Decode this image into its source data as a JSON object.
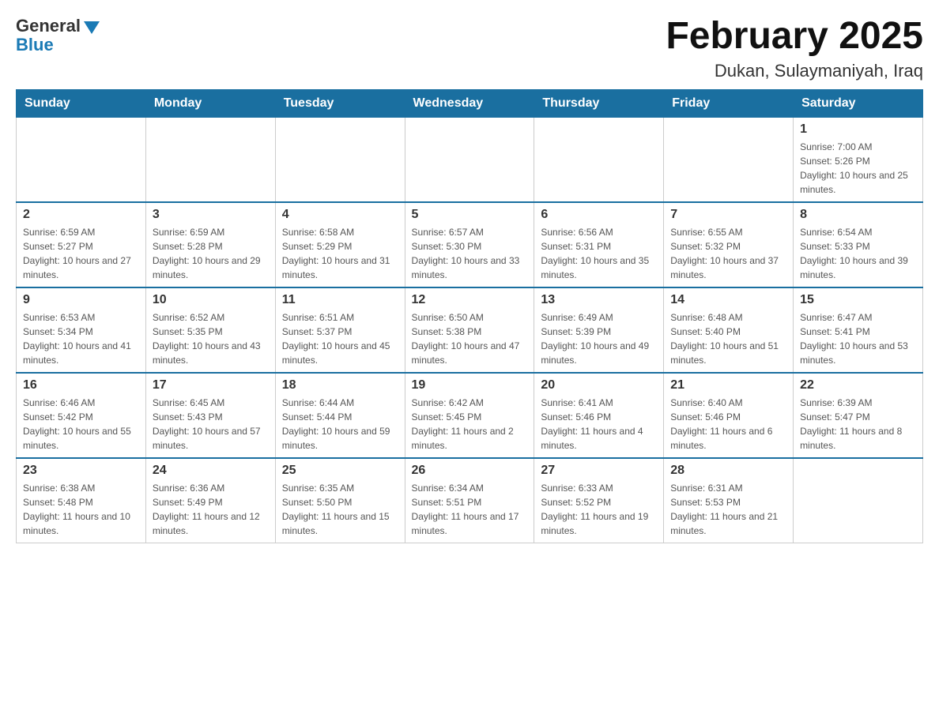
{
  "header": {
    "logo_general": "General",
    "logo_blue": "Blue",
    "title": "February 2025",
    "subtitle": "Dukan, Sulaymaniyah, Iraq"
  },
  "days_of_week": [
    "Sunday",
    "Monday",
    "Tuesday",
    "Wednesday",
    "Thursday",
    "Friday",
    "Saturday"
  ],
  "weeks": [
    [
      {
        "day": "",
        "sunrise": "",
        "sunset": "",
        "daylight": ""
      },
      {
        "day": "",
        "sunrise": "",
        "sunset": "",
        "daylight": ""
      },
      {
        "day": "",
        "sunrise": "",
        "sunset": "",
        "daylight": ""
      },
      {
        "day": "",
        "sunrise": "",
        "sunset": "",
        "daylight": ""
      },
      {
        "day": "",
        "sunrise": "",
        "sunset": "",
        "daylight": ""
      },
      {
        "day": "",
        "sunrise": "",
        "sunset": "",
        "daylight": ""
      },
      {
        "day": "1",
        "sunrise": "Sunrise: 7:00 AM",
        "sunset": "Sunset: 5:26 PM",
        "daylight": "Daylight: 10 hours and 25 minutes."
      }
    ],
    [
      {
        "day": "2",
        "sunrise": "Sunrise: 6:59 AM",
        "sunset": "Sunset: 5:27 PM",
        "daylight": "Daylight: 10 hours and 27 minutes."
      },
      {
        "day": "3",
        "sunrise": "Sunrise: 6:59 AM",
        "sunset": "Sunset: 5:28 PM",
        "daylight": "Daylight: 10 hours and 29 minutes."
      },
      {
        "day": "4",
        "sunrise": "Sunrise: 6:58 AM",
        "sunset": "Sunset: 5:29 PM",
        "daylight": "Daylight: 10 hours and 31 minutes."
      },
      {
        "day": "5",
        "sunrise": "Sunrise: 6:57 AM",
        "sunset": "Sunset: 5:30 PM",
        "daylight": "Daylight: 10 hours and 33 minutes."
      },
      {
        "day": "6",
        "sunrise": "Sunrise: 6:56 AM",
        "sunset": "Sunset: 5:31 PM",
        "daylight": "Daylight: 10 hours and 35 minutes."
      },
      {
        "day": "7",
        "sunrise": "Sunrise: 6:55 AM",
        "sunset": "Sunset: 5:32 PM",
        "daylight": "Daylight: 10 hours and 37 minutes."
      },
      {
        "day": "8",
        "sunrise": "Sunrise: 6:54 AM",
        "sunset": "Sunset: 5:33 PM",
        "daylight": "Daylight: 10 hours and 39 minutes."
      }
    ],
    [
      {
        "day": "9",
        "sunrise": "Sunrise: 6:53 AM",
        "sunset": "Sunset: 5:34 PM",
        "daylight": "Daylight: 10 hours and 41 minutes."
      },
      {
        "day": "10",
        "sunrise": "Sunrise: 6:52 AM",
        "sunset": "Sunset: 5:35 PM",
        "daylight": "Daylight: 10 hours and 43 minutes."
      },
      {
        "day": "11",
        "sunrise": "Sunrise: 6:51 AM",
        "sunset": "Sunset: 5:37 PM",
        "daylight": "Daylight: 10 hours and 45 minutes."
      },
      {
        "day": "12",
        "sunrise": "Sunrise: 6:50 AM",
        "sunset": "Sunset: 5:38 PM",
        "daylight": "Daylight: 10 hours and 47 minutes."
      },
      {
        "day": "13",
        "sunrise": "Sunrise: 6:49 AM",
        "sunset": "Sunset: 5:39 PM",
        "daylight": "Daylight: 10 hours and 49 minutes."
      },
      {
        "day": "14",
        "sunrise": "Sunrise: 6:48 AM",
        "sunset": "Sunset: 5:40 PM",
        "daylight": "Daylight: 10 hours and 51 minutes."
      },
      {
        "day": "15",
        "sunrise": "Sunrise: 6:47 AM",
        "sunset": "Sunset: 5:41 PM",
        "daylight": "Daylight: 10 hours and 53 minutes."
      }
    ],
    [
      {
        "day": "16",
        "sunrise": "Sunrise: 6:46 AM",
        "sunset": "Sunset: 5:42 PM",
        "daylight": "Daylight: 10 hours and 55 minutes."
      },
      {
        "day": "17",
        "sunrise": "Sunrise: 6:45 AM",
        "sunset": "Sunset: 5:43 PM",
        "daylight": "Daylight: 10 hours and 57 minutes."
      },
      {
        "day": "18",
        "sunrise": "Sunrise: 6:44 AM",
        "sunset": "Sunset: 5:44 PM",
        "daylight": "Daylight: 10 hours and 59 minutes."
      },
      {
        "day": "19",
        "sunrise": "Sunrise: 6:42 AM",
        "sunset": "Sunset: 5:45 PM",
        "daylight": "Daylight: 11 hours and 2 minutes."
      },
      {
        "day": "20",
        "sunrise": "Sunrise: 6:41 AM",
        "sunset": "Sunset: 5:46 PM",
        "daylight": "Daylight: 11 hours and 4 minutes."
      },
      {
        "day": "21",
        "sunrise": "Sunrise: 6:40 AM",
        "sunset": "Sunset: 5:46 PM",
        "daylight": "Daylight: 11 hours and 6 minutes."
      },
      {
        "day": "22",
        "sunrise": "Sunrise: 6:39 AM",
        "sunset": "Sunset: 5:47 PM",
        "daylight": "Daylight: 11 hours and 8 minutes."
      }
    ],
    [
      {
        "day": "23",
        "sunrise": "Sunrise: 6:38 AM",
        "sunset": "Sunset: 5:48 PM",
        "daylight": "Daylight: 11 hours and 10 minutes."
      },
      {
        "day": "24",
        "sunrise": "Sunrise: 6:36 AM",
        "sunset": "Sunset: 5:49 PM",
        "daylight": "Daylight: 11 hours and 12 minutes."
      },
      {
        "day": "25",
        "sunrise": "Sunrise: 6:35 AM",
        "sunset": "Sunset: 5:50 PM",
        "daylight": "Daylight: 11 hours and 15 minutes."
      },
      {
        "day": "26",
        "sunrise": "Sunrise: 6:34 AM",
        "sunset": "Sunset: 5:51 PM",
        "daylight": "Daylight: 11 hours and 17 minutes."
      },
      {
        "day": "27",
        "sunrise": "Sunrise: 6:33 AM",
        "sunset": "Sunset: 5:52 PM",
        "daylight": "Daylight: 11 hours and 19 minutes."
      },
      {
        "day": "28",
        "sunrise": "Sunrise: 6:31 AM",
        "sunset": "Sunset: 5:53 PM",
        "daylight": "Daylight: 11 hours and 21 minutes."
      },
      {
        "day": "",
        "sunrise": "",
        "sunset": "",
        "daylight": ""
      }
    ]
  ]
}
